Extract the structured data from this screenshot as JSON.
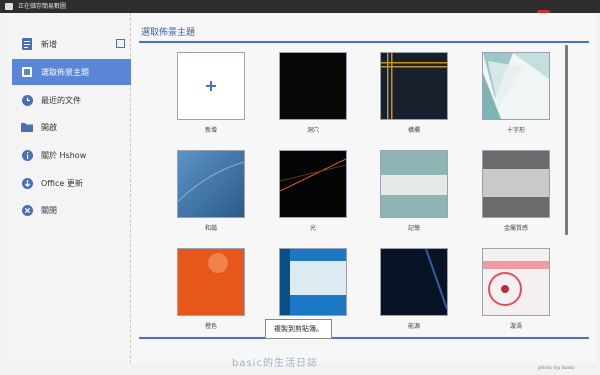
{
  "window": {
    "title": "正在儲存簡易數圖"
  },
  "brand": {
    "name": "hshow"
  },
  "sidebar": {
    "items": [
      {
        "label": "新增",
        "icon": "document-icon"
      },
      {
        "label": "選取佈景主題",
        "icon": "theme-icon"
      },
      {
        "label": "最近的文件",
        "icon": "recent-icon"
      },
      {
        "label": "開啟",
        "icon": "folder-icon"
      },
      {
        "label": "關於 Hshow",
        "icon": "info-icon"
      },
      {
        "label": "Office 更新",
        "icon": "update-icon"
      },
      {
        "label": "關閉",
        "icon": "close-icon"
      }
    ]
  },
  "main": {
    "heading": "選取佈景主題",
    "themes": [
      {
        "label": "新增"
      },
      {
        "label": "洞穴"
      },
      {
        "label": "橫欄"
      },
      {
        "label": "十字形"
      },
      {
        "label": "和諧"
      },
      {
        "label": "光"
      },
      {
        "label": "記憶"
      },
      {
        "label": "金屬質感"
      },
      {
        "label": "橙色"
      },
      {
        "label": ""
      },
      {
        "label": "能源"
      },
      {
        "label": "漩渦"
      }
    ]
  },
  "tooltip": {
    "text": "複製到剪貼簿。"
  },
  "watermark": {
    "text": "basic的生活日誌"
  },
  "credit": {
    "text": "photo by basic"
  },
  "colors": {
    "accent": "#5b85d6",
    "brand": "#c9302c"
  }
}
